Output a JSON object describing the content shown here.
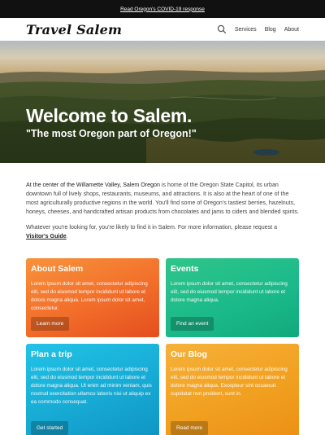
{
  "topbar": {
    "link": "Read Oregon's COVID-19 response"
  },
  "nav": {
    "logo": "Travel Salem",
    "items": [
      {
        "label": "Services"
      },
      {
        "label": "Blog"
      },
      {
        "label": "About"
      }
    ]
  },
  "hero": {
    "title": "Welcome to Salem.",
    "subtitle": "\"The most Oregon part of Oregon!\""
  },
  "intro": {
    "p1_strong": "At the center of the Willamette Valley, Salem Oregon",
    "p1_rest": " is home of the Oregon State Capitol, its urban downtown full of lively shops, restaurants, museums, and attractions. It is also at the heart of one of the most agriculturally productive regions in the world. You'll find some of Oregon's tastiest berries, hazelnuts, honeys, cheeses, and handcrafted artisan products from chocolates and jams to ciders and blended spirits.",
    "p2_text": "Whatever you're looking for, you're likely to find it in Salem. For more information, please request a ",
    "p2_link": "Visitor's Guide",
    "p2_end": "."
  },
  "cards": [
    {
      "title": "About Salem",
      "body": "Lorem ipsum dolor sit amet, consectetur adipiscing elit, sed do eiusmod tempor incididunt ut labore et dolore magna aliqua. Lorem ipsum dolor sit amet, consectetur.",
      "button": "Learn more"
    },
    {
      "title": "Events",
      "body": "Lorem ipsum dolor sit amet, consectetur adipiscing elit, sed do eiusmod tempor incididunt ut labore et dolore magna aliqua.",
      "button": "Find an event"
    },
    {
      "title": "Plan a trip",
      "body": "Lorem ipsum dolor sit amet, consectetur adipiscing elit, sed do eiusmod tempor incididunt ut labore et dolore magna aliqua. Ut enim ad minim veniam, quis nostrud exercitation ullamco laboris nisi ut aliquip ex ea commodo consequat.",
      "button": "Get started"
    },
    {
      "title": "Our Blog",
      "body": "Lorem ipsum dolor sit amet, consectetur adipiscing elit, sed do eiusmod tempor incididunt ut labore et dolore magna aliqua. Excepteur sint occaecat cupidatat non proident, sunt in.",
      "button": "Read more"
    }
  ],
  "colors": {
    "about": "#f26e2a",
    "events": "#1ab98a",
    "plan": "#17aad4",
    "blog": "#f1a020"
  },
  "icons": {
    "search": "search-icon"
  }
}
